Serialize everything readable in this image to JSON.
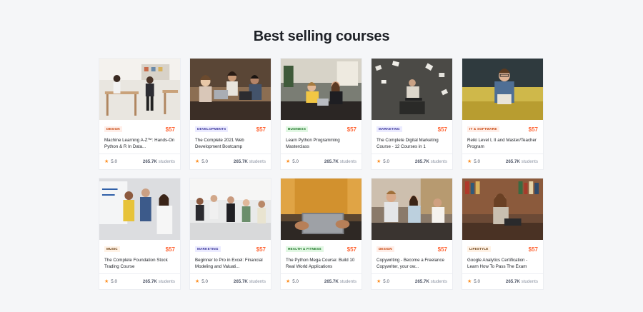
{
  "section": {
    "title": "Best selling courses"
  },
  "courses": [
    {
      "category": "DESIGN",
      "badge_bg": "#ffeee8",
      "badge_fg": "#c33c00",
      "price": "$57",
      "title": "Machine Learning A-Z™: Hands-On Python & R In Data...",
      "rating": "5.0",
      "students_count": "265.7K",
      "students_label": "students",
      "image": "office"
    },
    {
      "category": "DEVELOPMENTS",
      "badge_bg": "#ebebff",
      "badge_fg": "#342f98",
      "price": "$57",
      "title": "The Complete 2021 Web Development Bootcamp",
      "rating": "5.0",
      "students_count": "265.7K",
      "students_label": "students",
      "image": "team-laptops"
    },
    {
      "category": "BUSINESS",
      "badge_bg": "#e1f7e3",
      "badge_fg": "#15711f",
      "price": "$57",
      "title": "Learn Python Programming Masterclass",
      "rating": "5.0",
      "students_count": "265.7K",
      "students_label": "students",
      "image": "cafe"
    },
    {
      "category": "MARKETING",
      "badge_bg": "#ebebff",
      "badge_fg": "#342f98",
      "price": "$57",
      "title": "The Complete Digital Marketing Course - 12 Courses in 1",
      "rating": "5.0",
      "students_count": "265.7K",
      "students_label": "students",
      "image": "papers"
    },
    {
      "category": "IT & SOFTWARE",
      "badge_bg": "#ffeee8",
      "badge_fg": "#c33c00",
      "price": "$57",
      "title": "Reiki Level I, II and Master/Teacher Program",
      "rating": "5.0",
      "students_count": "265.7K",
      "students_label": "students",
      "image": "man-couch"
    },
    {
      "category": "MUSIC",
      "badge_bg": "#fff2e5",
      "badge_fg": "#65390c",
      "price": "$57",
      "title": "The Complete Foundation Stock Trading Course",
      "rating": "5.0",
      "students_count": "265.7K",
      "students_label": "students",
      "image": "whiteboard"
    },
    {
      "category": "MARKETING",
      "badge_bg": "#ebebff",
      "badge_fg": "#342f98",
      "price": "$57",
      "title": "Beginner to Pro in Excel: Financial Modeling and Valuati...",
      "rating": "5.0",
      "students_count": "265.7K",
      "students_label": "students",
      "image": "meeting"
    },
    {
      "category": "HEALTH & FITNESS",
      "badge_bg": "#e1f7e3",
      "badge_fg": "#15711f",
      "price": "$57",
      "title": "The Python Mega Course: Build 10 Real World Applications",
      "rating": "5.0",
      "students_count": "265.7K",
      "students_label": "students",
      "image": "laptop-hands"
    },
    {
      "category": "DESIGN",
      "badge_bg": "#ffeee8",
      "badge_fg": "#c33c00",
      "price": "$57",
      "title": "Copywriting - Become a Freelance Copywriter, your ow...",
      "rating": "5.0",
      "students_count": "265.7K",
      "students_label": "students",
      "image": "study-group"
    },
    {
      "category": "LIFESTYLE",
      "badge_bg": "#fff2e5",
      "badge_fg": "#65390c",
      "price": "$57",
      "title": "Google Analytics Certification - Learn How To Pass The Exam",
      "rating": "5.0",
      "students_count": "265.7K",
      "students_label": "students",
      "image": "library"
    }
  ]
}
